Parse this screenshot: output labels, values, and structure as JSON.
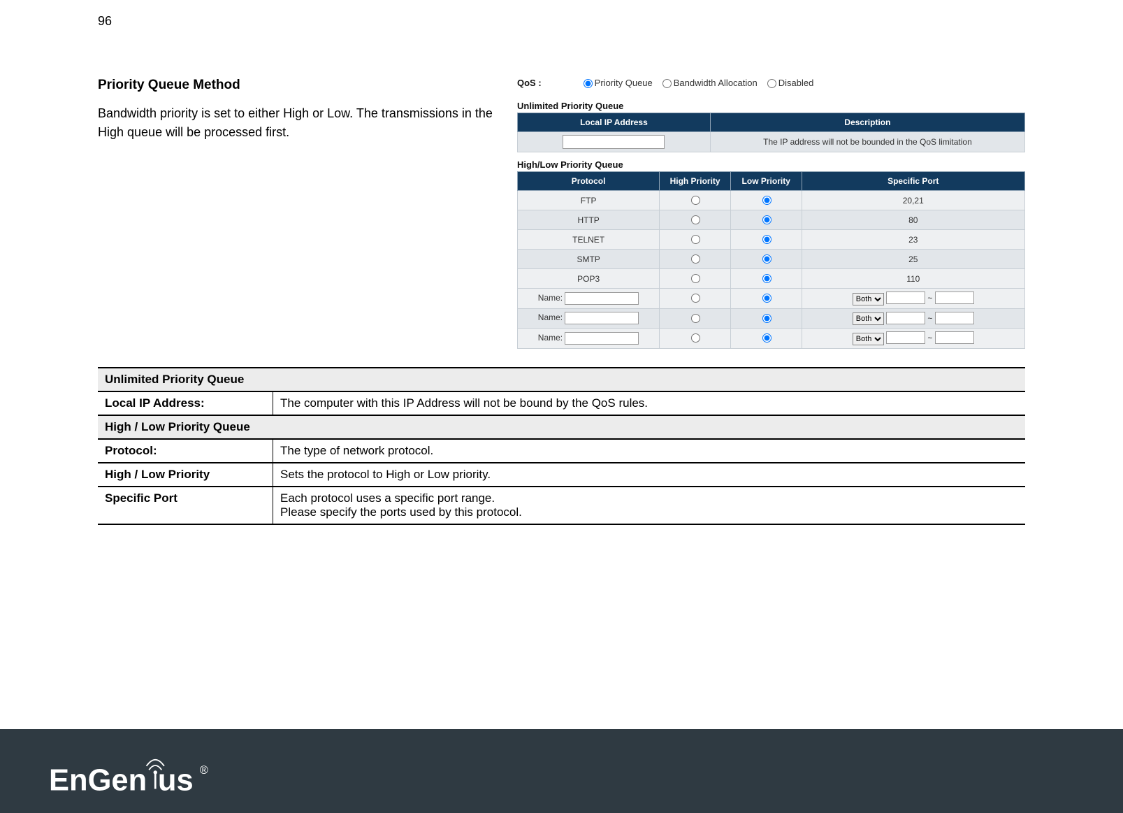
{
  "pageNumber": "96",
  "section": {
    "title": "Priority Queue Method",
    "body": "Bandwidth priority is set to either High or Low. The transmissions in the High queue will be processed first."
  },
  "screenshot": {
    "qosLabel": "QoS :",
    "radios": {
      "priority": "Priority Queue",
      "bandwidth": "Bandwidth Allocation",
      "disabled": "Disabled"
    },
    "upq": {
      "heading": "Unlimited Priority Queue",
      "cols": {
        "ip": "Local IP Address",
        "desc": "Description"
      },
      "descText": "The IP address will not be bounded in the QoS limitation"
    },
    "hlq": {
      "heading": "High/Low Priority Queue",
      "cols": {
        "proto": "Protocol",
        "high": "High Priority",
        "low": "Low Priority",
        "port": "Specific Port"
      },
      "rows": [
        {
          "proto": "FTP",
          "port": "20,21"
        },
        {
          "proto": "HTTP",
          "port": "80"
        },
        {
          "proto": "TELNET",
          "port": "23"
        },
        {
          "proto": "SMTP",
          "port": "25"
        },
        {
          "proto": "POP3",
          "port": "110"
        }
      ],
      "custom": [
        {
          "nameLabel": "Name:",
          "dir": "Both",
          "sep": "~"
        },
        {
          "nameLabel": "Name:",
          "dir": "Both",
          "sep": "~"
        },
        {
          "nameLabel": "Name:",
          "dir": "Both",
          "sep": "~"
        }
      ]
    }
  },
  "descTable": {
    "groups": [
      {
        "title": "Unlimited Priority Queue",
        "rows": [
          {
            "label": "Local IP Address:",
            "text": "The computer with this IP Address will not be bound by the QoS rules."
          }
        ]
      },
      {
        "title": "High / Low Priority Queue",
        "rows": [
          {
            "label": "Protocol:",
            "text": "The type of network protocol."
          },
          {
            "label": "High / Low Priority",
            "text": "Sets the protocol to High or Low priority."
          },
          {
            "label": "Specific Port",
            "text": "Each protocol uses a specific port range.\nPlease specify the ports used by this protocol."
          }
        ]
      }
    ]
  },
  "brand": "EnGenius",
  "brandSuffix": "®"
}
